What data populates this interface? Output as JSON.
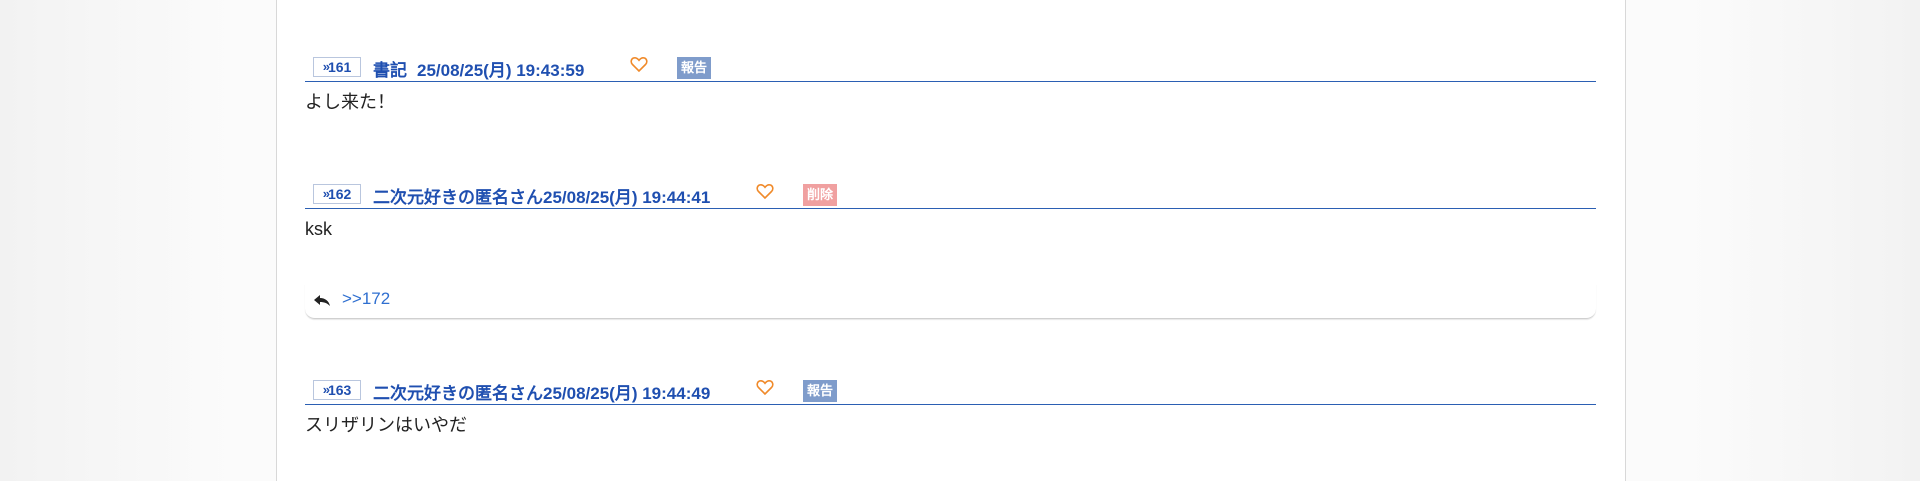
{
  "posts": [
    {
      "number": "161",
      "name": "書記",
      "date": "25/08/25(月) 19:43:59",
      "badge": "報告",
      "body": "よし来た！"
    },
    {
      "number": "162",
      "name": "二次元好きの匿名さん",
      "date": "25/08/25(月) 19:44:41",
      "badge": "削除",
      "body": "ksk",
      "reply": ">>172"
    },
    {
      "number": "163",
      "name": "二次元好きの匿名さん",
      "date": "25/08/25(月) 19:44:49",
      "badge": "報告",
      "body": "スリザリンはいやだ"
    }
  ],
  "icons": {
    "heart": "heart-icon",
    "reply": "reply-icon",
    "res_arrow": "double-chevron-right-icon"
  },
  "colors": {
    "accent": "#1f4fb0",
    "heart": "#f08a2a",
    "report_badge": "#7f9ccb",
    "delete_badge": "#f0a0a0",
    "reply_link": "#2f6fd0"
  }
}
